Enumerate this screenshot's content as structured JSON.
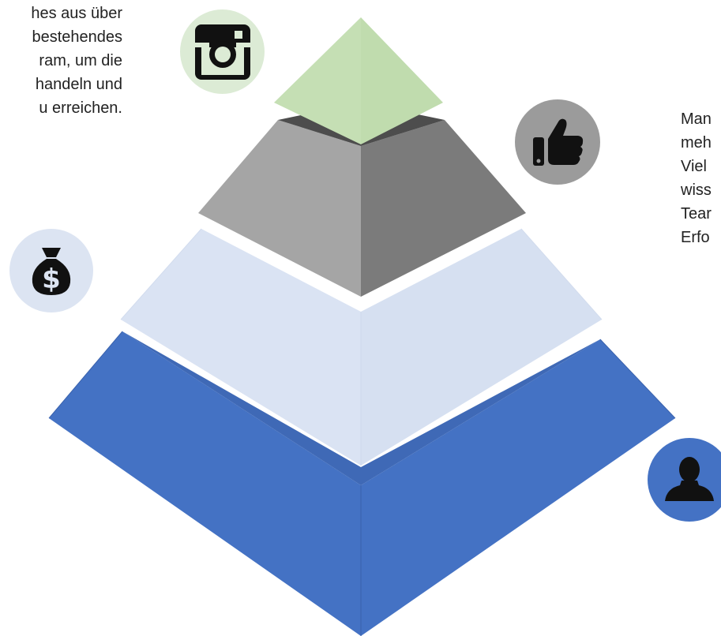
{
  "texts": {
    "left_lines": [
      "hes aus über",
      "bestehendes",
      "ram, um die",
      "handeln und",
      "u erreichen."
    ],
    "right_lines": [
      "Man",
      "meh",
      "Viel",
      "wiss",
      "Tear",
      "Erfo"
    ]
  },
  "icons": {
    "top_tier": "instagram-icon",
    "second_tier": "thumbs-up-icon",
    "third_tier": "money-bag-icon",
    "bottom_tier": "person-icon"
  },
  "colors": {
    "tier1_green": "#c5dfb4",
    "tier2_gray": "#a5a5a5",
    "tier3_lightblue": "#dae3f3",
    "tier4_blue": "#4472c4",
    "icon_dark": "#111111"
  }
}
